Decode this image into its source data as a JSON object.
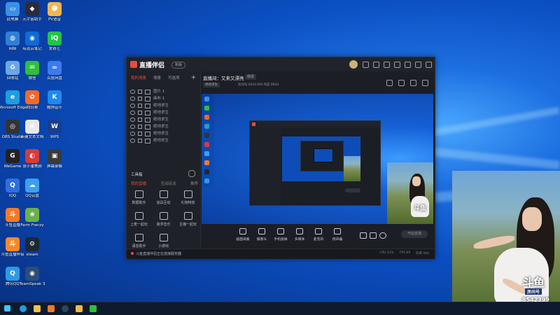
{
  "desktop": {
    "icons": [
      {
        "label": "此电脑",
        "color": "#3b8fe8",
        "glyph": "▭"
      },
      {
        "label": "网络",
        "color": "#2f7fd6",
        "glyph": "◍"
      },
      {
        "label": "回收站",
        "color": "#6aa7e8",
        "glyph": "♻"
      },
      {
        "label": "Microsoft Edge",
        "color": "#1e9de0",
        "glyph": "e"
      },
      {
        "label": "OBS Studio",
        "color": "#333333",
        "glyph": "◎"
      },
      {
        "label": "WeGame",
        "color": "#222222",
        "glyph": "G"
      },
      {
        "label": "IQQ",
        "color": "#2d6fe0",
        "glyph": "Q"
      },
      {
        "label": "斗鱼直播",
        "color": "#f07a2a",
        "glyph": "斗"
      },
      {
        "label": "斗鱼直播伴侣",
        "color": "#f28a2a",
        "glyph": "斗"
      },
      {
        "label": "腾讯QQ",
        "color": "#2b9ae8",
        "glyph": "Q"
      },
      {
        "label": "元宇宙助手",
        "color": "#2b2b3b",
        "glyph": "◆"
      },
      {
        "label": "有道云笔记",
        "color": "#0f6bd8",
        "glyph": "◉"
      },
      {
        "label": "微信",
        "color": "#2fbf3a",
        "glyph": "✉"
      },
      {
        "label": "向日葵",
        "color": "#f06a2a",
        "glyph": "✿"
      },
      {
        "label": "新建文本文档",
        "color": "#e8e8e8",
        "glyph": "≡"
      },
      {
        "label": "张小潘美颜",
        "color": "#d83a3a",
        "glyph": "◐"
      },
      {
        "label": "QQ云盘",
        "color": "#3aa0f0",
        "glyph": "☁"
      },
      {
        "label": "Farm Frenzy",
        "color": "#6ab04c",
        "glyph": "❀"
      },
      {
        "label": "steam",
        "color": "#1b2838",
        "glyph": "⚙"
      },
      {
        "label": "TeamSpeak 3",
        "color": "#2a4d7a",
        "glyph": "◉"
      },
      {
        "label": "PV语音",
        "color": "#f2b84b",
        "glyph": "☻"
      },
      {
        "label": "爱奇艺",
        "color": "#23c34a",
        "glyph": "iQ"
      },
      {
        "label": "百度网盘",
        "color": "#3a7cf0",
        "glyph": "∞"
      },
      {
        "label": "酷狗音乐",
        "color": "#1d8af0",
        "glyph": "K"
      },
      {
        "label": "WPS",
        "color": "#1a3d8f",
        "glyph": "W"
      },
      {
        "label": "屏幕录像",
        "color": "#3a3a3a",
        "glyph": "▣"
      }
    ]
  },
  "app": {
    "title": "直播伴侣",
    "version": "新版",
    "left_tabs": [
      "我的场景",
      "场景",
      "可选项"
    ],
    "sources": [
      "图片 1",
      "画布 1",
      "绝地求生",
      "绝地求生",
      "绝地求生",
      "绝地求生",
      "绝地求生",
      "绝地求生"
    ],
    "tools_heading": "工具箱",
    "tool_tabs": [
      "我的直播",
      "互动玩法",
      "推荐"
    ],
    "tools": [
      "数据助手",
      "道具互动",
      "礼物特效",
      "上麦一起玩",
      "悬浮音乐",
      "主播一起玩",
      "语音助手",
      "小游戏"
    ],
    "stream_title": "直播间：又来又漂亮",
    "edit_label": "修改",
    "game_tag": "绝地求生",
    "stream_info": "房间号 8542399  热度 8644",
    "bottom_buttons": [
      "画面采集",
      "摄像头",
      "手机投屏",
      "多媒体",
      "麦克风",
      "扬声器"
    ],
    "start_label": "开始直播",
    "status_left": "斗鱼直播伴侣正在连接服务器",
    "status_right": [
      "CPU 23%",
      "FPS 60",
      "码率 0kb"
    ]
  },
  "overlay": {
    "watermark_logo": "斗鱼",
    "watermark_sub": "房间号",
    "room_number": "8542399"
  }
}
